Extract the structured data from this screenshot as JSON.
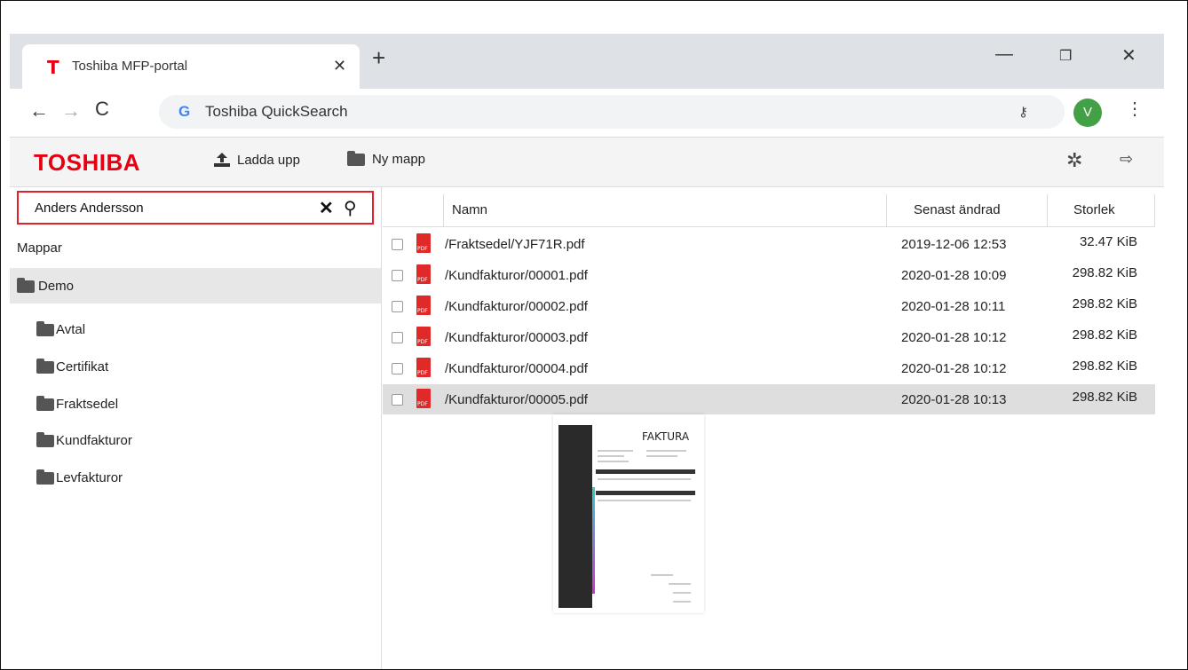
{
  "browser": {
    "tab_title": "Toshiba MFP-portal",
    "tab_icon": "T",
    "address_text": "Toshiba QuickSearch",
    "profile_initial": "V"
  },
  "toolbar": {
    "logo": "TOSHIBA",
    "upload_label": "Ladda upp",
    "new_folder_label": "Ny mapp"
  },
  "sidebar": {
    "search_value": "Anders Andersson",
    "folders_heading": "Mappar",
    "root": "Demo",
    "items": [
      "Avtal",
      "Certifikat",
      "Fraktsedel",
      "Kundfakturor",
      "Levfakturor"
    ]
  },
  "files": {
    "headers": {
      "name": "Namn",
      "modified": "Senast ändrad",
      "size": "Storlek"
    },
    "rows": [
      {
        "name": "/Fraktsedel/YJF71R.pdf",
        "modified": "2019-12-06 12:53",
        "size": "32.47 KiB"
      },
      {
        "name": "/Kundfakturor/00001.pdf",
        "modified": "2020-01-28 10:09",
        "size": "298.82 KiB"
      },
      {
        "name": "/Kundfakturor/00002.pdf",
        "modified": "2020-01-28 10:11",
        "size": "298.82 KiB"
      },
      {
        "name": "/Kundfakturor/00003.pdf",
        "modified": "2020-01-28 10:12",
        "size": "298.82 KiB"
      },
      {
        "name": "/Kundfakturor/00004.pdf",
        "modified": "2020-01-28 10:12",
        "size": "298.82 KiB"
      },
      {
        "name": "/Kundfakturor/00005.pdf",
        "modified": "2020-01-28 10:13",
        "size": "298.82 KiB"
      }
    ],
    "selected_index": 5
  },
  "preview": {
    "title": "FAKTURA"
  },
  "colors": {
    "brand": "#e60012",
    "search_border": "#e0202a",
    "avatar": "#43a047"
  }
}
